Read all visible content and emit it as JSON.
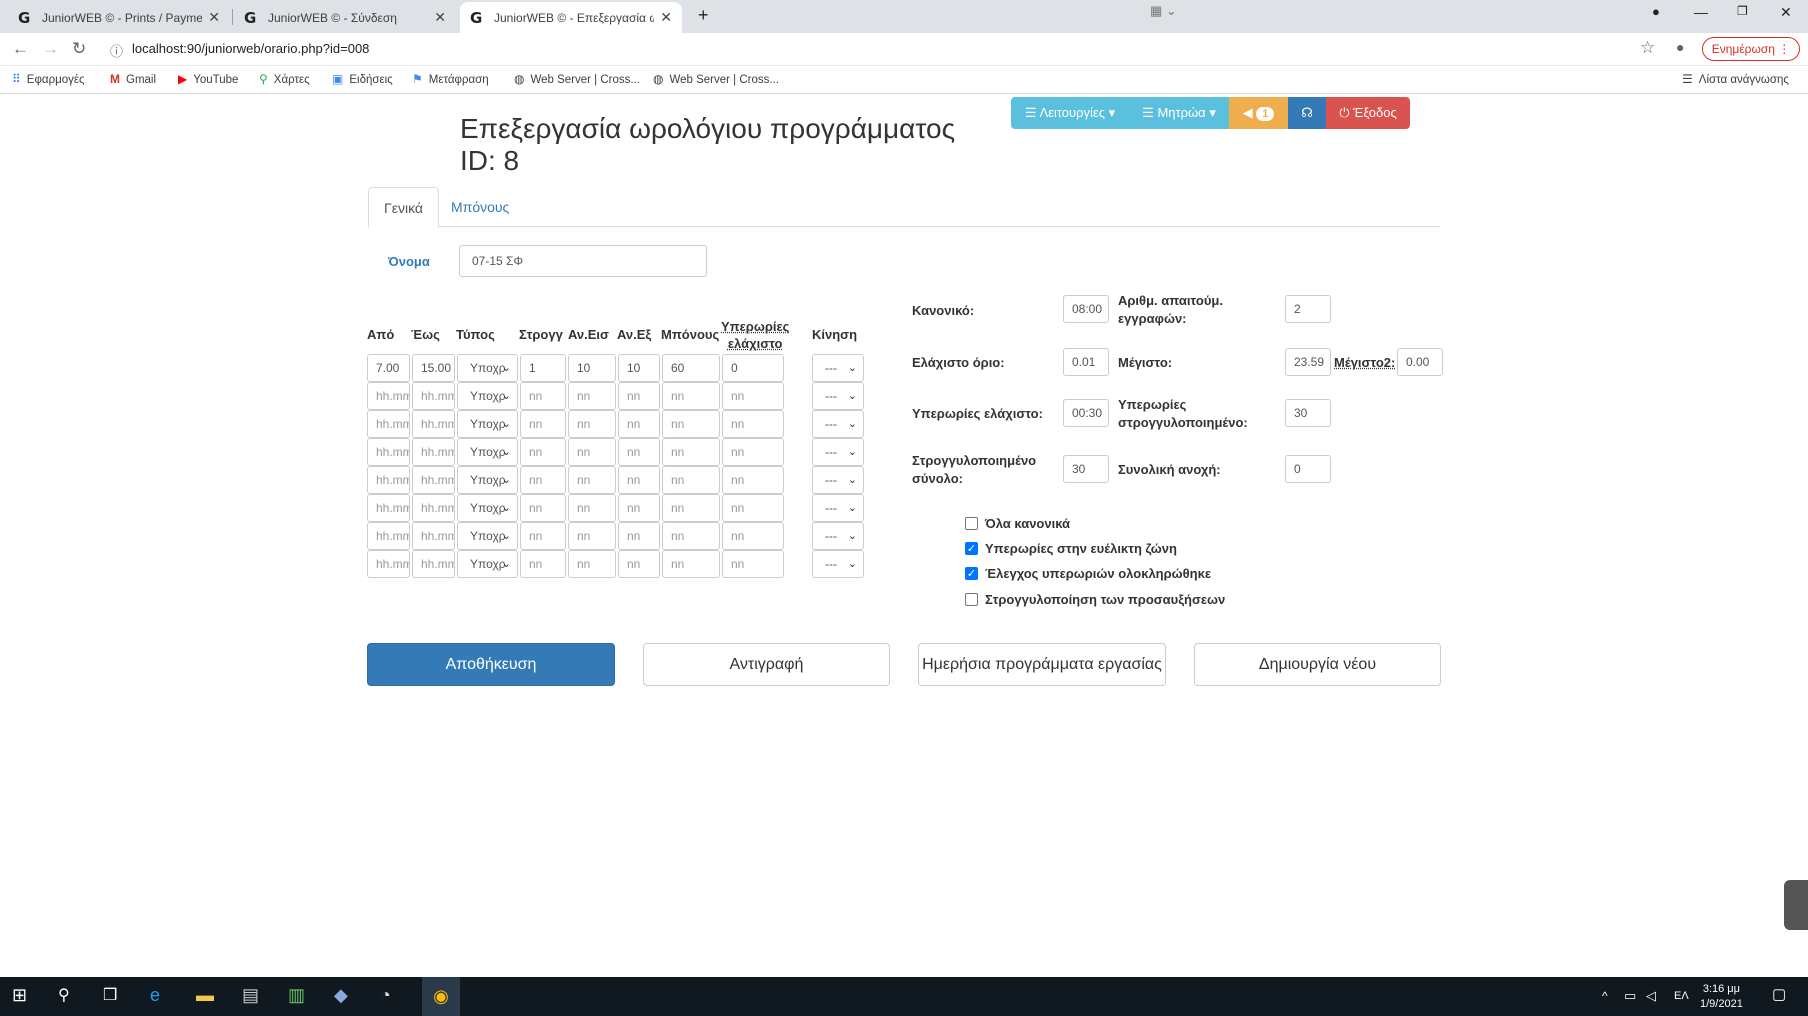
{
  "browser": {
    "tabs": [
      {
        "title": "JuniorWEB © - Prints / Payments"
      },
      {
        "title": "JuniorWEB © - Σύνδεση"
      },
      {
        "title": "JuniorWEB © - Επεξεργασία ωρολ"
      }
    ],
    "url": "localhost:90/juniorweb/orario.php?id=008",
    "update_label": "Ενημέρωση",
    "bookmarks": [
      "Εφαρμογές",
      "Gmail",
      "YouTube",
      "Χάρτες",
      "Ειδήσεις",
      "Μετάφραση",
      "Web Server | Cross...",
      "Web Server | Cross..."
    ],
    "reading_list": "Λίστα ανάγνωσης"
  },
  "navbar": {
    "functions": "Λειτουργίες",
    "registers": "Μητρώα",
    "notifications_count": "1",
    "logout": "Έξοδος"
  },
  "page": {
    "title": "Επεξεργασία ωρολόγιου προγράμματος",
    "id_line": "ID: 8",
    "tabs": [
      "Γενικά",
      "Μπόνους"
    ],
    "name_label": "Όνομα",
    "name_value": "07-15 ΣΦ"
  },
  "table": {
    "headers": [
      "Από",
      "Έως",
      "Τύπος",
      "Στρογγ",
      "Αν.Εισ",
      "Αν.Εξ",
      "Μπόνους",
      "Υπερωρίες",
      "ελάχιστο",
      "Κίνηση"
    ],
    "first_row": {
      "from": "7.00",
      "to": "15.00",
      "type": "Υποχρ",
      "round": "1",
      "in": "10",
      "out": "10",
      "bonus": "60",
      "overtime": "0",
      "move": "---"
    },
    "placeholder_time": "hh.mm",
    "placeholder_num": "nn",
    "type_default": "Υποχρ",
    "move_default": "---"
  },
  "settings": {
    "normal_label": "Κανονικό:",
    "normal_value": "08:00",
    "required_label": "Αριθμ. απαιτούμ. εγγραφών:",
    "required_value": "2",
    "min_limit_label": "Ελάχιστο όριο:",
    "min_limit_value": "0.01",
    "max_label": "Μέγιστο:",
    "max_value": "23.59",
    "max2_label": "Μέγιστο2:",
    "max2_value": "0.00",
    "overtime_min_label": "Υπερωρίες ελάχιστο:",
    "overtime_min_value": "00:30",
    "overtime_round_label": "Υπερωρίες στρογγυλοποιημένο:",
    "overtime_round_value": "30",
    "rounded_total_label": "Στρογγυλοποιημένο σύνολο:",
    "rounded_total_value": "30",
    "tolerance_label": "Συνολική ανοχή:",
    "tolerance_value": "0"
  },
  "checks": [
    {
      "label": "Όλα κανονικά",
      "checked": false
    },
    {
      "label": "Υπερωρίες στην ευέλικτη ζώνη",
      "checked": true
    },
    {
      "label": "Έλεγχος υπερωριών ολοκληρώθηκε",
      "checked": true
    },
    {
      "label": "Στρογγυλοποίηση των προσαυξήσεων",
      "checked": false
    }
  ],
  "buttons": {
    "save": "Αποθήκευση",
    "copy": "Αντιγραφή",
    "daily": "Ημερήσια προγράμματα εργασίας",
    "create": "Δημιουργία νέου"
  },
  "taskbar": {
    "time": "3:16 μμ",
    "date": "1/9/2021",
    "lang": "ΕΛ"
  }
}
